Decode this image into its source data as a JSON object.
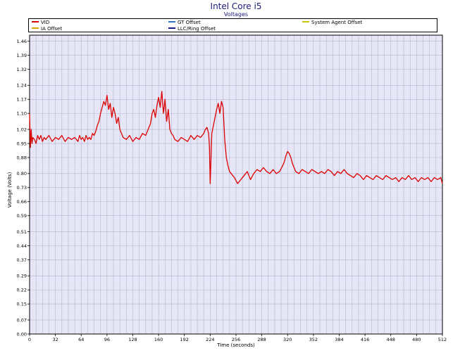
{
  "header": {
    "title": "Intel Core i5",
    "subtitle": "Voltages"
  },
  "legend": [
    {
      "label": "VID",
      "color": "#dd0000"
    },
    {
      "label": "GT Offset",
      "color": "#2e75c8"
    },
    {
      "label": "System Agent Offset",
      "color": "#c8c800"
    },
    {
      "label": "IA Offset",
      "color": "#e8a000"
    },
    {
      "label": "LLC/Ring Offset",
      "color": "#1a1a8a"
    }
  ],
  "chart_data": {
    "type": "line",
    "title": "Intel Core i5",
    "subtitle": "Voltages",
    "xlabel": "Time (seconds)",
    "ylabel": "Voltage (Volts)",
    "xlim": [
      0,
      512
    ],
    "ylim": [
      0,
      1.49
    ],
    "xticks": [
      0,
      32,
      64,
      96,
      128,
      160,
      192,
      224,
      256,
      288,
      320,
      352,
      384,
      416,
      448,
      480,
      512
    ],
    "yticks": [
      0.0,
      0.07,
      0.15,
      0.22,
      0.29,
      0.37,
      0.44,
      0.51,
      0.59,
      0.66,
      0.73,
      0.8,
      0.88,
      0.95,
      1.02,
      1.1,
      1.17,
      1.24,
      1.32,
      1.39,
      1.46
    ],
    "grid": true,
    "legend_position": "top",
    "series": [
      {
        "name": "VID",
        "color": "#dd0000",
        "x": [
          0,
          1,
          2,
          3,
          4,
          6,
          8,
          10,
          12,
          14,
          16,
          18,
          20,
          24,
          28,
          32,
          36,
          40,
          44,
          48,
          52,
          56,
          60,
          62,
          64,
          66,
          68,
          70,
          72,
          74,
          76,
          78,
          80,
          82,
          84,
          86,
          88,
          90,
          92,
          94,
          96,
          98,
          100,
          102,
          104,
          106,
          108,
          110,
          112,
          116,
          120,
          124,
          128,
          132,
          136,
          140,
          144,
          148,
          150,
          152,
          154,
          156,
          158,
          160,
          162,
          164,
          166,
          168,
          170,
          172,
          174,
          176,
          178,
          180,
          184,
          188,
          192,
          196,
          200,
          204,
          208,
          212,
          216,
          218,
          220,
          222,
          223,
          224,
          226,
          228,
          230,
          232,
          234,
          236,
          238,
          240,
          241,
          242,
          244,
          246,
          248,
          250,
          254,
          258,
          262,
          266,
          270,
          274,
          278,
          282,
          286,
          290,
          294,
          298,
          302,
          306,
          310,
          314,
          316,
          318,
          320,
          322,
          324,
          326,
          328,
          330,
          334,
          338,
          342,
          346,
          350,
          354,
          358,
          362,
          366,
          370,
          374,
          378,
          382,
          386,
          390,
          394,
          398,
          402,
          406,
          410,
          414,
          418,
          422,
          426,
          430,
          434,
          438,
          442,
          446,
          450,
          454,
          458,
          462,
          466,
          470,
          474,
          478,
          482,
          486,
          490,
          494,
          498,
          502,
          506,
          510,
          512
        ],
        "values": [
          1.1,
          0.93,
          1.02,
          0.95,
          0.98,
          0.97,
          0.95,
          0.99,
          0.97,
          0.99,
          0.96,
          0.98,
          0.97,
          0.99,
          0.96,
          0.98,
          0.97,
          0.99,
          0.96,
          0.98,
          0.97,
          0.98,
          0.96,
          0.99,
          0.97,
          0.98,
          0.96,
          0.99,
          0.97,
          0.98,
          0.97,
          1.0,
          0.99,
          1.01,
          1.04,
          1.06,
          1.1,
          1.13,
          1.16,
          1.14,
          1.19,
          1.12,
          1.15,
          1.08,
          1.13,
          1.1,
          1.05,
          1.08,
          1.02,
          0.98,
          0.97,
          0.99,
          0.96,
          0.98,
          0.97,
          1.0,
          0.99,
          1.03,
          1.05,
          1.1,
          1.12,
          1.08,
          1.14,
          1.18,
          1.13,
          1.21,
          1.1,
          1.17,
          1.06,
          1.12,
          1.02,
          1.0,
          0.99,
          0.97,
          0.96,
          0.98,
          0.97,
          0.96,
          0.99,
          0.97,
          0.99,
          0.98,
          1.0,
          1.02,
          1.03,
          1.0,
          0.94,
          0.75,
          1.0,
          1.04,
          1.08,
          1.12,
          1.15,
          1.1,
          1.16,
          1.13,
          1.05,
          0.97,
          0.88,
          0.84,
          0.81,
          0.8,
          0.78,
          0.75,
          0.77,
          0.79,
          0.81,
          0.77,
          0.8,
          0.82,
          0.81,
          0.83,
          0.81,
          0.8,
          0.82,
          0.8,
          0.81,
          0.84,
          0.86,
          0.89,
          0.91,
          0.9,
          0.88,
          0.85,
          0.83,
          0.81,
          0.8,
          0.82,
          0.81,
          0.8,
          0.82,
          0.81,
          0.8,
          0.81,
          0.8,
          0.82,
          0.81,
          0.79,
          0.81,
          0.8,
          0.82,
          0.8,
          0.79,
          0.78,
          0.8,
          0.79,
          0.77,
          0.79,
          0.78,
          0.77,
          0.79,
          0.78,
          0.77,
          0.79,
          0.78,
          0.77,
          0.78,
          0.76,
          0.78,
          0.77,
          0.79,
          0.77,
          0.78,
          0.76,
          0.78,
          0.77,
          0.78,
          0.76,
          0.78,
          0.77,
          0.78,
          0.75
        ]
      },
      {
        "name": "GT Offset",
        "color": "#2e75c8",
        "x": [],
        "values": []
      },
      {
        "name": "System Agent Offset",
        "color": "#c8c800",
        "x": [],
        "values": []
      },
      {
        "name": "IA Offset",
        "color": "#e8a000",
        "x": [],
        "values": []
      },
      {
        "name": "LLC/Ring Offset",
        "color": "#1a1a8a",
        "x": [],
        "values": []
      }
    ]
  },
  "colors": {
    "plot_background": "#e6e6f6",
    "grid": "#b4b4d2",
    "title": "#1a1a7a"
  }
}
